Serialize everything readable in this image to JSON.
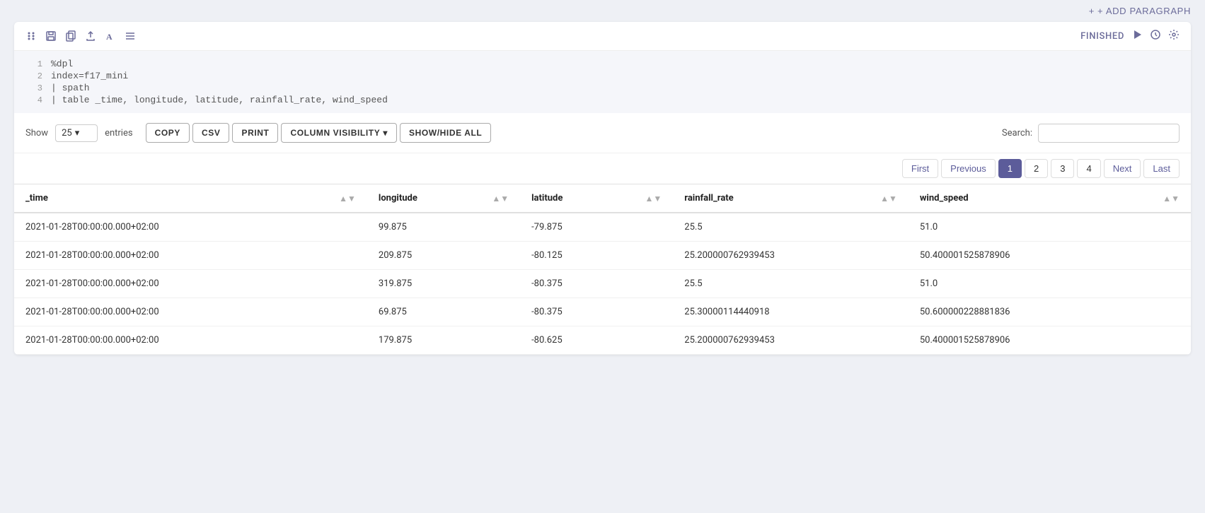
{
  "topbar": {
    "add_paragraph_label": "+ ADD PARAGRAPH"
  },
  "cell": {
    "toolbar": {
      "icons": [
        "grid-icon",
        "save-icon",
        "copy-file-icon",
        "upload-icon",
        "text-icon",
        "list-icon"
      ],
      "status_label": "FINISHED",
      "run_icon": "play-icon",
      "clock_icon": "clock-icon",
      "settings_icon": "gear-icon"
    },
    "code": {
      "lines": [
        {
          "number": "1",
          "content": "%dpl"
        },
        {
          "number": "2",
          "content": "index=f17_mini"
        },
        {
          "number": "3",
          "content": "| spath"
        },
        {
          "number": "4",
          "content": "| table _time, longitude, latitude, rainfall_rate, wind_speed"
        }
      ]
    },
    "table_controls": {
      "show_label": "Show",
      "entries_value": "25",
      "entries_label": "entries",
      "copy_btn": "COPY",
      "csv_btn": "CSV",
      "print_btn": "PRINT",
      "col_vis_btn": "COLUMN VISIBILITY",
      "show_hide_btn": "SHOW/HIDE ALL",
      "search_label": "Search:"
    },
    "pagination": {
      "first": "First",
      "previous": "Previous",
      "pages": [
        "1",
        "2",
        "3",
        "4"
      ],
      "next": "Next",
      "last": "Last",
      "active_page": "1"
    },
    "table": {
      "columns": [
        {
          "key": "_time",
          "label": "_time"
        },
        {
          "key": "longitude",
          "label": "longitude"
        },
        {
          "key": "latitude",
          "label": "latitude"
        },
        {
          "key": "rainfall_rate",
          "label": "rainfall_rate"
        },
        {
          "key": "wind_speed",
          "label": "wind_speed"
        }
      ],
      "rows": [
        {
          "_time": "2021-01-28T00:00:00.000+02:00",
          "longitude": "99.875",
          "latitude": "-79.875",
          "rainfall_rate": "25.5",
          "wind_speed": "51.0"
        },
        {
          "_time": "2021-01-28T00:00:00.000+02:00",
          "longitude": "209.875",
          "latitude": "-80.125",
          "rainfall_rate": "25.200000762939453",
          "wind_speed": "50.400001525878906"
        },
        {
          "_time": "2021-01-28T00:00:00.000+02:00",
          "longitude": "319.875",
          "latitude": "-80.375",
          "rainfall_rate": "25.5",
          "wind_speed": "51.0"
        },
        {
          "_time": "2021-01-28T00:00:00.000+02:00",
          "longitude": "69.875",
          "latitude": "-80.375",
          "rainfall_rate": "25.30000114440918",
          "wind_speed": "50.600000228881836"
        },
        {
          "_time": "2021-01-28T00:00:00.000+02:00",
          "longitude": "179.875",
          "latitude": "-80.625",
          "rainfall_rate": "25.200000762939453",
          "wind_speed": "50.400001525878906"
        }
      ]
    }
  }
}
